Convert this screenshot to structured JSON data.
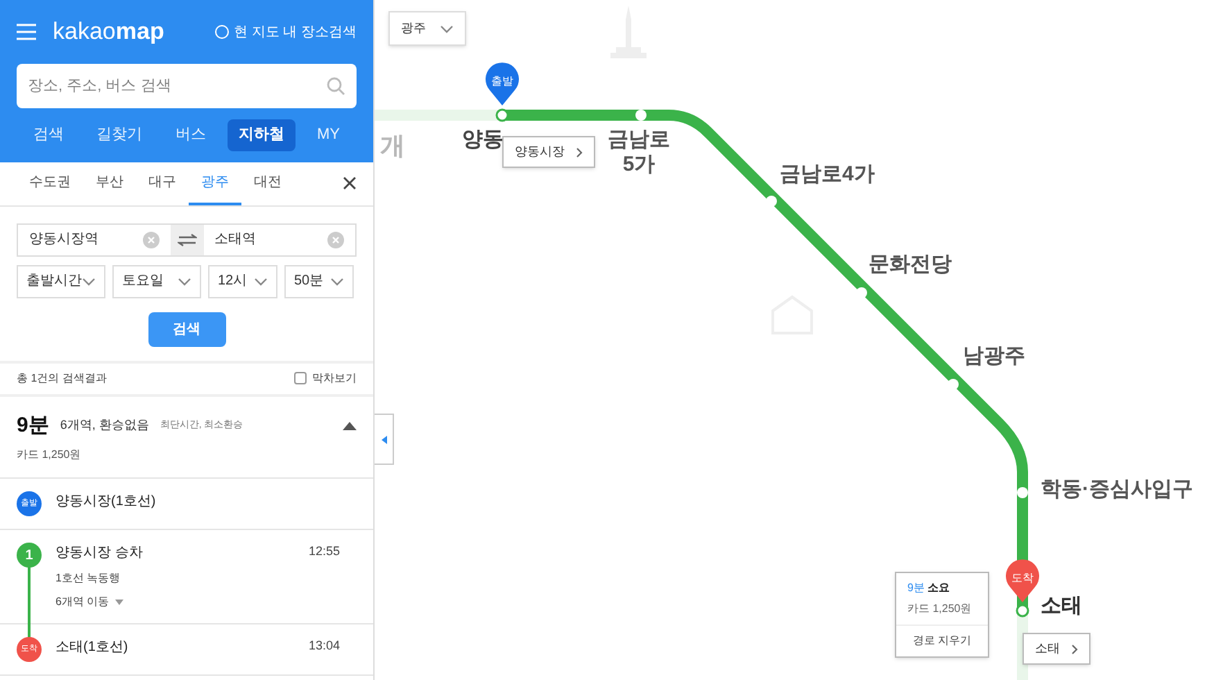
{
  "header": {
    "logo_plain": "kakao",
    "logo_bold": "map",
    "area_search": {
      "label": "현 지도 내 장소검색",
      "checked": false
    }
  },
  "search": {
    "placeholder": "장소, 주소, 버스 검색"
  },
  "nav": [
    {
      "label": "검색",
      "selected": false
    },
    {
      "label": "길찾기",
      "selected": false
    },
    {
      "label": "버스",
      "selected": false
    },
    {
      "label": "지하철",
      "selected": true
    },
    {
      "label": "MY",
      "selected": false
    }
  ],
  "regions": [
    {
      "label": "수도권",
      "selected": false
    },
    {
      "label": "부산",
      "selected": false
    },
    {
      "label": "대구",
      "selected": false
    },
    {
      "label": "광주",
      "selected": true
    },
    {
      "label": "대전",
      "selected": false
    }
  ],
  "route_form": {
    "from": "양동시장역",
    "to": "소태역",
    "selects": [
      "출발시간",
      "토요일",
      "12시",
      "50분"
    ],
    "search_button": "검색"
  },
  "results": {
    "count": "총 1건의 검색결과",
    "last_train": {
      "label": "막차보기",
      "checked": false
    }
  },
  "route": {
    "expanded": true,
    "time": "9분",
    "stations": "6개역, 환승없음",
    "tags": "최단시간, 최소환승",
    "fare": "카드 1,250원",
    "steps": [
      {
        "kind": "start",
        "badge": "출발",
        "title": "양동시장(1호선)"
      },
      {
        "kind": "board",
        "badge": "1",
        "title": "양동시장 승차",
        "time": "12:55",
        "line": "1호선 녹동행",
        "moves": "6개역 이동"
      },
      {
        "kind": "end",
        "badge": "도착",
        "title": "소태(1호선)",
        "time": "13:04"
      }
    ]
  },
  "map": {
    "region": "광주",
    "faded_label": "개",
    "stations": [
      {
        "label": "양동",
        "kind": "start"
      },
      {
        "label": "금남로\n5가",
        "kind": "stop"
      },
      {
        "label": "금남로4가",
        "kind": "stop"
      },
      {
        "label": "문화전당",
        "kind": "stop"
      },
      {
        "label": "남광주",
        "kind": "stop"
      },
      {
        "label": "학동·증심사입구",
        "kind": "stop"
      },
      {
        "label": "소태",
        "kind": "end"
      }
    ],
    "start_pin": "출발",
    "end_pin": "도착",
    "start_popup": "양동시장",
    "end_popup": "소태",
    "info": {
      "time": "9분",
      "time_suffix": "소요",
      "fare": "카드 1,250원",
      "clear": "경로 지우기"
    }
  }
}
